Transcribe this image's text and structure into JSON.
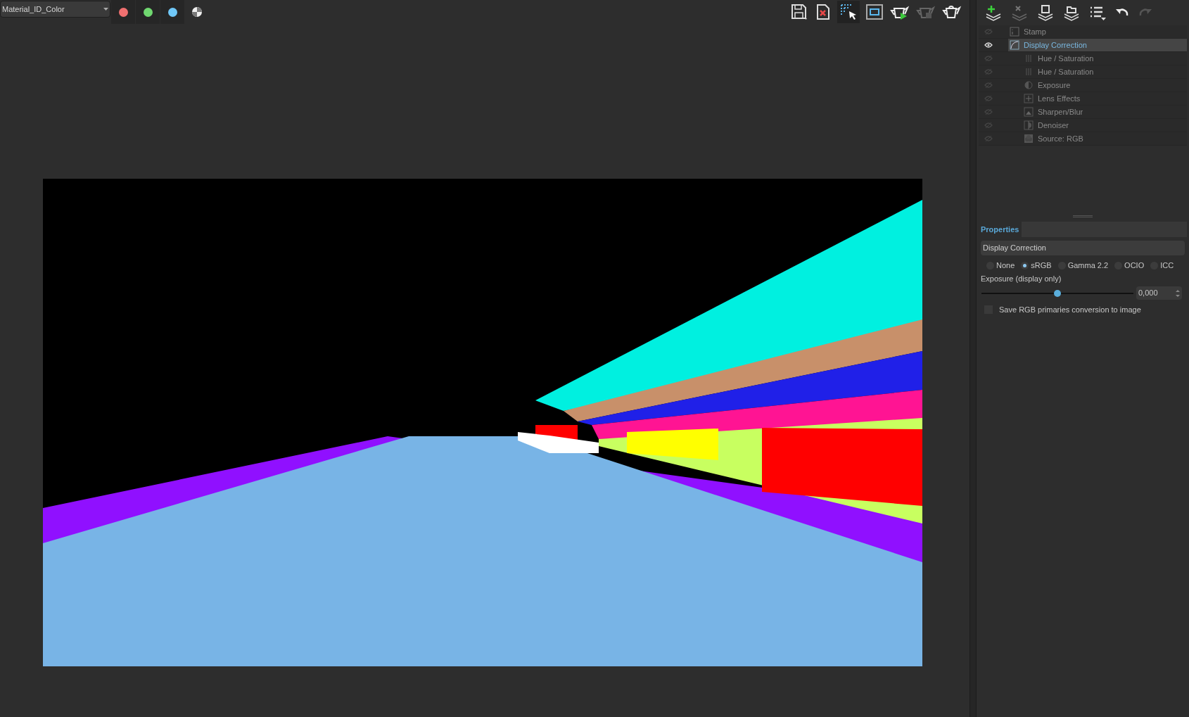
{
  "channel_select": {
    "value": "Material_ID_Color"
  },
  "channels": [
    {
      "color": "#f07070",
      "selected": true
    },
    {
      "color": "#70d870",
      "selected": true
    },
    {
      "color": "#70c8f8",
      "selected": true
    }
  ],
  "layers": [
    {
      "label": "Stamp",
      "visible": false,
      "selected": false,
      "kind": "stamp"
    },
    {
      "label": "Display Correction",
      "visible": true,
      "selected": true,
      "kind": "curve",
      "children": [
        {
          "label": "Hue / Saturation",
          "visible": false,
          "selected": false,
          "kind": "bars"
        },
        {
          "label": "Hue / Saturation",
          "visible": false,
          "selected": false,
          "kind": "bars"
        },
        {
          "label": "Exposure",
          "visible": false,
          "selected": false,
          "kind": "exposure"
        },
        {
          "label": "Lens Effects",
          "visible": false,
          "selected": false,
          "kind": "plus"
        },
        {
          "label": "Sharpen/Blur",
          "visible": false,
          "selected": false,
          "kind": "sharpen"
        },
        {
          "label": "Denoiser",
          "visible": false,
          "selected": false,
          "kind": "half"
        },
        {
          "label": "Source: RGB",
          "visible": false,
          "selected": false,
          "kind": "rgb"
        }
      ]
    }
  ],
  "properties": {
    "title": "Properties",
    "section": "Display Correction",
    "modes": [
      {
        "label": "None",
        "selected": false
      },
      {
        "label": "sRGB",
        "selected": true
      },
      {
        "label": "Gamma 2.2",
        "selected": false
      },
      {
        "label": "OCIO",
        "selected": false
      },
      {
        "label": "ICC",
        "selected": false
      }
    ],
    "exposure": {
      "label": "Exposure (display only)",
      "level": 0.5,
      "value": "0,000"
    },
    "save_option": {
      "label": "Save RGB primaries conversion to image",
      "checked": false
    }
  }
}
